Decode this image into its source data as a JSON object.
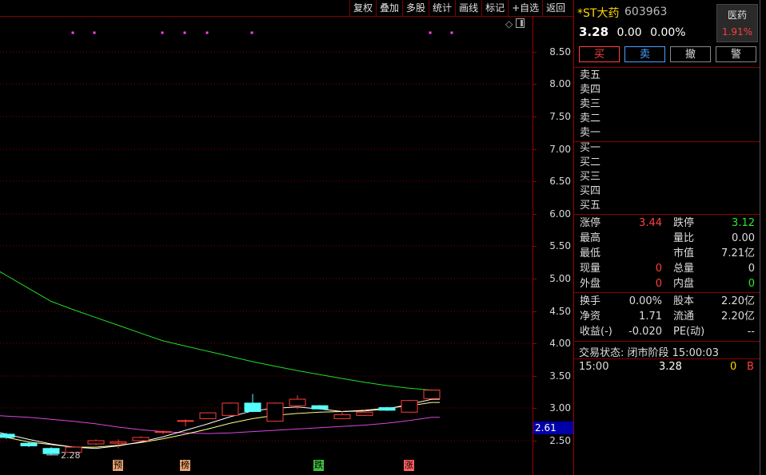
{
  "toolbar": {
    "items": [
      "复权",
      "叠加",
      "多股",
      "统计",
      "画线",
      "标记",
      "+自选",
      "返回"
    ]
  },
  "chart": {
    "y_ticks": [
      "8.50",
      "8.00",
      "7.50",
      "7.00",
      "6.50",
      "6.00",
      "5.50",
      "5.00",
      "4.50",
      "4.00",
      "3.50",
      "3.00",
      "2.50"
    ],
    "last_price_badge": "2.61",
    "low_marker": "2.28",
    "event_tags": [
      {
        "label": "预",
        "color": "#e8a070"
      },
      {
        "label": "榜",
        "color": "#e8a070"
      },
      {
        "label": "跌",
        "color": "#3fbf3f"
      },
      {
        "label": "涨",
        "color": "#ff6060"
      }
    ],
    "colors": {
      "up": "#ff3b3b",
      "down": "#55ffff",
      "ma_long": "#22dd22",
      "ma_mid": "#ffff88",
      "ma_short": "#ffffff",
      "ma_low": "#dd44dd",
      "dot": "#ff44ff",
      "grid": "#8b0000"
    }
  },
  "chart_data": {
    "type": "candlestick",
    "ylim": [
      2.25,
      8.75
    ],
    "candles": [
      {
        "o": 2.6,
        "c": 2.55,
        "h": 2.62,
        "l": 2.53
      },
      {
        "o": 2.46,
        "c": 2.42,
        "h": 2.48,
        "l": 2.4
      },
      {
        "o": 2.38,
        "c": 2.3,
        "h": 2.4,
        "l": 2.28
      },
      {
        "o": 2.32,
        "c": 2.4,
        "h": 2.42,
        "l": 2.3
      },
      {
        "o": 2.45,
        "c": 2.5,
        "h": 2.52,
        "l": 2.43
      },
      {
        "o": 2.46,
        "c": 2.48,
        "h": 2.52,
        "l": 2.38
      },
      {
        "o": 2.5,
        "c": 2.55,
        "h": 2.57,
        "l": 2.48
      },
      {
        "o": 2.63,
        "c": 2.64,
        "h": 2.66,
        "l": 2.6
      },
      {
        "o": 2.8,
        "c": 2.81,
        "h": 2.83,
        "l": 2.72
      },
      {
        "o": 2.84,
        "c": 2.93,
        "h": 2.94,
        "l": 2.84
      },
      {
        "o": 2.89,
        "c": 3.08,
        "h": 3.09,
        "l": 2.88
      },
      {
        "o": 3.08,
        "c": 2.95,
        "h": 3.22,
        "l": 2.94
      },
      {
        "o": 2.8,
        "c": 3.08,
        "h": 3.09,
        "l": 2.79
      },
      {
        "o": 3.04,
        "c": 3.14,
        "h": 3.2,
        "l": 2.99
      },
      {
        "o": 3.04,
        "c": 2.99,
        "h": 3.05,
        "l": 2.98
      },
      {
        "o": 2.84,
        "c": 2.9,
        "h": 2.96,
        "l": 2.83
      },
      {
        "o": 2.89,
        "c": 2.94,
        "h": 2.98,
        "l": 2.88
      },
      {
        "o": 3.01,
        "c": 2.97,
        "h": 3.02,
        "l": 2.96
      },
      {
        "o": 2.94,
        "c": 3.12,
        "h": 3.13,
        "l": 2.94
      },
      {
        "o": 3.15,
        "c": 3.28,
        "h": 3.29,
        "l": 3.15
      }
    ],
    "ma_long": [
      5.05,
      4.85,
      4.65,
      4.52,
      4.4,
      4.28,
      4.16,
      4.04,
      3.96,
      3.88,
      3.8,
      3.72,
      3.65,
      3.58,
      3.52,
      3.46,
      3.4,
      3.35,
      3.31,
      3.28
    ],
    "ma_mid": [
      2.55,
      2.48,
      2.44,
      2.4,
      2.4,
      2.43,
      2.47,
      2.53,
      2.6,
      2.68,
      2.77,
      2.84,
      2.89,
      2.92,
      2.94,
      2.95,
      2.97,
      3.0,
      3.04,
      3.09
    ],
    "ma_short": [
      2.6,
      2.52,
      2.45,
      2.4,
      2.38,
      2.42,
      2.48,
      2.56,
      2.66,
      2.76,
      2.87,
      2.96,
      3.0,
      3.02,
      2.99,
      2.95,
      2.96,
      2.99,
      3.06,
      3.14
    ],
    "ma_low": [
      2.88,
      2.86,
      2.83,
      2.8,
      2.76,
      2.71,
      2.67,
      2.64,
      2.62,
      2.61,
      2.62,
      2.64,
      2.66,
      2.68,
      2.7,
      2.72,
      2.74,
      2.77,
      2.81,
      2.86
    ]
  },
  "stock": {
    "name": "*ST大药",
    "code": "603963",
    "price": "3.28",
    "change": "0.00",
    "change_pct": "0.00%",
    "sector": "医药",
    "sector_pct": "1.91%"
  },
  "trade_buttons": [
    "买",
    "卖",
    "撤",
    "警"
  ],
  "order_book": {
    "sells": [
      "卖五",
      "卖四",
      "卖三",
      "卖二",
      "卖一"
    ],
    "buys": [
      "买一",
      "买二",
      "买三",
      "买四",
      "买五"
    ]
  },
  "stats": [
    {
      "l1": "涨停",
      "v1": "3.44",
      "c1": "red",
      "l2": "跌停",
      "v2": "3.12",
      "c2": "green"
    },
    {
      "l1": "最高",
      "v1": "",
      "c1": "white",
      "l2": "量比",
      "v2": "0.00",
      "c2": "white"
    },
    {
      "l1": "最低",
      "v1": "",
      "c1": "white",
      "l2": "市值",
      "v2": "7.21亿",
      "c2": "white"
    },
    {
      "l1": "现量",
      "v1": "0",
      "c1": "red",
      "l2": "总量",
      "v2": "0",
      "c2": "white"
    },
    {
      "l1": "外盘",
      "v1": "0",
      "c1": "red",
      "l2": "内盘",
      "v2": "0",
      "c2": "green"
    }
  ],
  "fundamentals": [
    {
      "l1": "换手",
      "v1": "0.00%",
      "l2": "股本",
      "v2": "2.20亿"
    },
    {
      "l1": "净资",
      "v1": "1.71",
      "l2": "流通",
      "v2": "2.20亿"
    },
    {
      "l1": "收益(-)",
      "v1": "-0.020",
      "l2": "PE(动)",
      "v2": "--"
    }
  ],
  "trade_status": "交易状态: 闭市阶段 15:00:03",
  "tick": {
    "time": "15:00",
    "price": "3.28",
    "volume": "0",
    "side": "B"
  }
}
